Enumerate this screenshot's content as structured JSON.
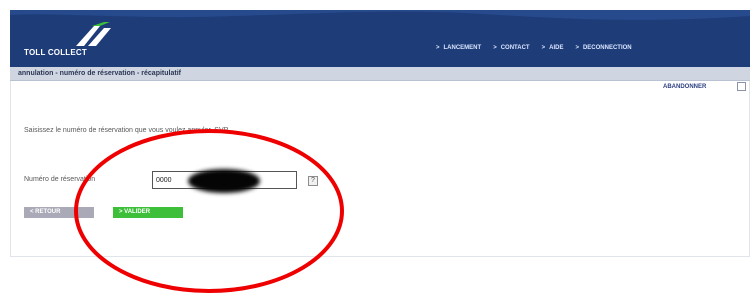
{
  "header": {
    "logo_text": "TOLL COLLECT",
    "nav": [
      {
        "label": "LANCEMENT"
      },
      {
        "label": "CONTACT"
      },
      {
        "label": "AIDE"
      },
      {
        "label": "DECONNECTION"
      }
    ]
  },
  "breadcrumb": "annulation - numéro de réservation - récapitulatif",
  "abandon_label": "ABANDONNER",
  "form": {
    "instruction": "Saisissez le numéro de réservation que vous voulez annuler, SVP",
    "label": "Numéro de réservation",
    "value": "0000",
    "help": "?"
  },
  "buttons": {
    "back": "< RETOUR",
    "validate": "> VALIDER"
  },
  "colors": {
    "header": "#1d3c78",
    "validate": "#3dbf3a",
    "highlight_ellipse": "#ee0000"
  }
}
